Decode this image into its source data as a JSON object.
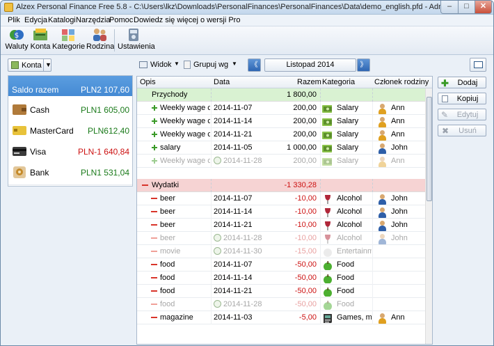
{
  "window": {
    "title": "Alzex Personal Finance Free 5.8 - C:\\Users\\lkz\\Downloads\\PersonalFinances\\PersonalFinances\\Data\\demo_english.pfd - Administrator",
    "min": "–",
    "max": "□",
    "close": "✕"
  },
  "menu": [
    "Plik",
    "Edycja",
    "Katalogi",
    "Narzędzia",
    "Pomoc",
    "Dowiedz się więcej o wersji Pro"
  ],
  "toolbar": {
    "waluty": "Waluty",
    "konta": "Konta",
    "kategorie": "Kategorie",
    "rodzina": "Rodzina",
    "ustawienia": "Ustawienia"
  },
  "controls": {
    "konta_btn": "Konta",
    "widok": "Widok",
    "grupuj": "Grupuj wg",
    "period": "Listopad 2014",
    "prev": "《",
    "next": "》"
  },
  "accounts": [
    {
      "name": "Saldo razem",
      "value": "PLN2 107,60",
      "selected": true
    },
    {
      "name": "Cash",
      "value": "PLN1 605,00",
      "color": "#1a7a1a"
    },
    {
      "name": "MasterCard",
      "value": "PLN612,40",
      "color": "#1a7a1a"
    },
    {
      "name": "Visa",
      "value": "PLN-1 640,84",
      "color": "#cc1010"
    },
    {
      "name": "Bank",
      "value": "PLN1 531,04",
      "color": "#1a7a1a"
    }
  ],
  "columns": {
    "opis": "Opis",
    "data": "Data",
    "razem": "Razem",
    "kategoria": "Kategoria",
    "czlonek": "Członek rodziny"
  },
  "income_group": {
    "label": "Przychody",
    "total": "1 800,00"
  },
  "income_rows": [
    {
      "opis": "Weekly wage chec",
      "data": "2014-11-07",
      "razem": "200,00",
      "kategoria": "Salary",
      "member": "Ann",
      "ghost": false
    },
    {
      "opis": "Weekly wage chec",
      "data": "2014-11-14",
      "razem": "200,00",
      "kategoria": "Salary",
      "member": "Ann",
      "ghost": false
    },
    {
      "opis": "Weekly wage chec",
      "data": "2014-11-21",
      "razem": "200,00",
      "kategoria": "Salary",
      "member": "Ann",
      "ghost": false
    },
    {
      "opis": "salary",
      "data": "2014-11-05",
      "razem": "1 000,00",
      "kategoria": "Salary",
      "member": "John",
      "ghost": false
    },
    {
      "opis": "Weekly wage chec",
      "data": "2014-11-28",
      "razem": "200,00",
      "kategoria": "Salary",
      "member": "Ann",
      "ghost": true
    }
  ],
  "expense_group": {
    "label": "Wydatki",
    "total": "-1 330,28"
  },
  "expense_rows": [
    {
      "opis": "beer",
      "data": "2014-11-07",
      "razem": "-10,00",
      "kategoria": "Alcohol",
      "member": "John",
      "ghost": false
    },
    {
      "opis": "beer",
      "data": "2014-11-14",
      "razem": "-10,00",
      "kategoria": "Alcohol",
      "member": "John",
      "ghost": false
    },
    {
      "opis": "beer",
      "data": "2014-11-21",
      "razem": "-10,00",
      "kategoria": "Alcohol",
      "member": "John",
      "ghost": false
    },
    {
      "opis": "beer",
      "data": "2014-11-28",
      "razem": "-10,00",
      "kategoria": "Alcohol",
      "member": "John",
      "ghost": true
    },
    {
      "opis": "movie",
      "data": "2014-11-30",
      "razem": "-15,00",
      "kategoria": "Entertainmen",
      "member": "",
      "ghost": true
    },
    {
      "opis": "food",
      "data": "2014-11-07",
      "razem": "-50,00",
      "kategoria": "Food",
      "member": "",
      "ghost": false
    },
    {
      "opis": "food",
      "data": "2014-11-14",
      "razem": "-50,00",
      "kategoria": "Food",
      "member": "",
      "ghost": false
    },
    {
      "opis": "food",
      "data": "2014-11-21",
      "razem": "-50,00",
      "kategoria": "Food",
      "member": "",
      "ghost": false
    },
    {
      "opis": "food",
      "data": "2014-11-28",
      "razem": "-50,00",
      "kategoria": "Food",
      "member": "",
      "ghost": true
    },
    {
      "opis": "magazine",
      "data": "2014-11-03",
      "razem": "-5,00",
      "kategoria": "Games, maga",
      "member": "Ann",
      "ghost": false
    }
  ],
  "side_buttons": {
    "dodaj": "Dodaj",
    "kopiuj": "Kopiuj",
    "edytuj": "Edytuj",
    "usun": "Usuń"
  },
  "colors": {
    "income_bg": "#d9f2d2",
    "expense_bg": "#f6d3d3",
    "selected": "#3d84cf",
    "negative": "#cc1010",
    "positive": "#1a7a1a"
  }
}
